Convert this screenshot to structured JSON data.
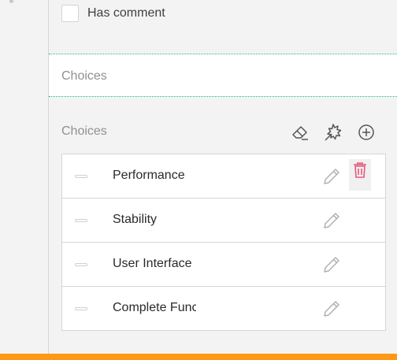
{
  "comment": {
    "label": "Has comment",
    "checked": false
  },
  "choices_header": {
    "label": "Choices"
  },
  "choices_editor": {
    "label": "Choices",
    "tools": [
      "eraser-icon",
      "magic-wand-icon",
      "add-circle-icon"
    ],
    "items": [
      {
        "label": "Performance"
      },
      {
        "label": "Stability"
      },
      {
        "label": "User Interface"
      },
      {
        "label": "Complete Functionality"
      }
    ]
  },
  "colors": {
    "accent": "#19b394",
    "danger": "#e8577b",
    "bottom_bar": "#ff9814"
  }
}
